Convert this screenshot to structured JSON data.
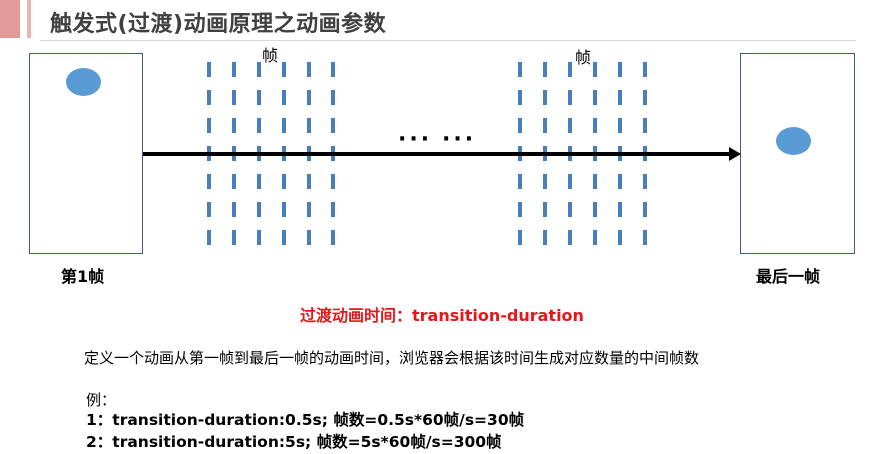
{
  "slide": {
    "title": "触发式(过渡)动画原理之动画参数",
    "accent_color": "#E29A99",
    "title_color": "#404040"
  },
  "diagram": {
    "first_frame_label": "第1帧",
    "last_frame_label": "最后一帧",
    "frame_tag_left": "帧",
    "frame_tag_right": "帧",
    "ellipsis_1": "···",
    "ellipsis_2": "···",
    "box_border_color": "#3C5C86",
    "ball_color": "#5B9BD5",
    "dash_color": "#4A7EBB"
  },
  "text": {
    "duration_title": "过渡动画时间：transition-duration",
    "duration_title_color": "#E6161B",
    "description": "定义一个动画从第一帧到最后一帧的动画时间，浏览器会根据该时间生成对应数量的中间帧数",
    "example_head": "例：",
    "example_1": "1：transition-duration:0.5s;  帧数=0.5s*60帧/s=30帧",
    "example_2": "2：transition-duration:5s;  帧数=5s*60帧/s=300帧"
  }
}
